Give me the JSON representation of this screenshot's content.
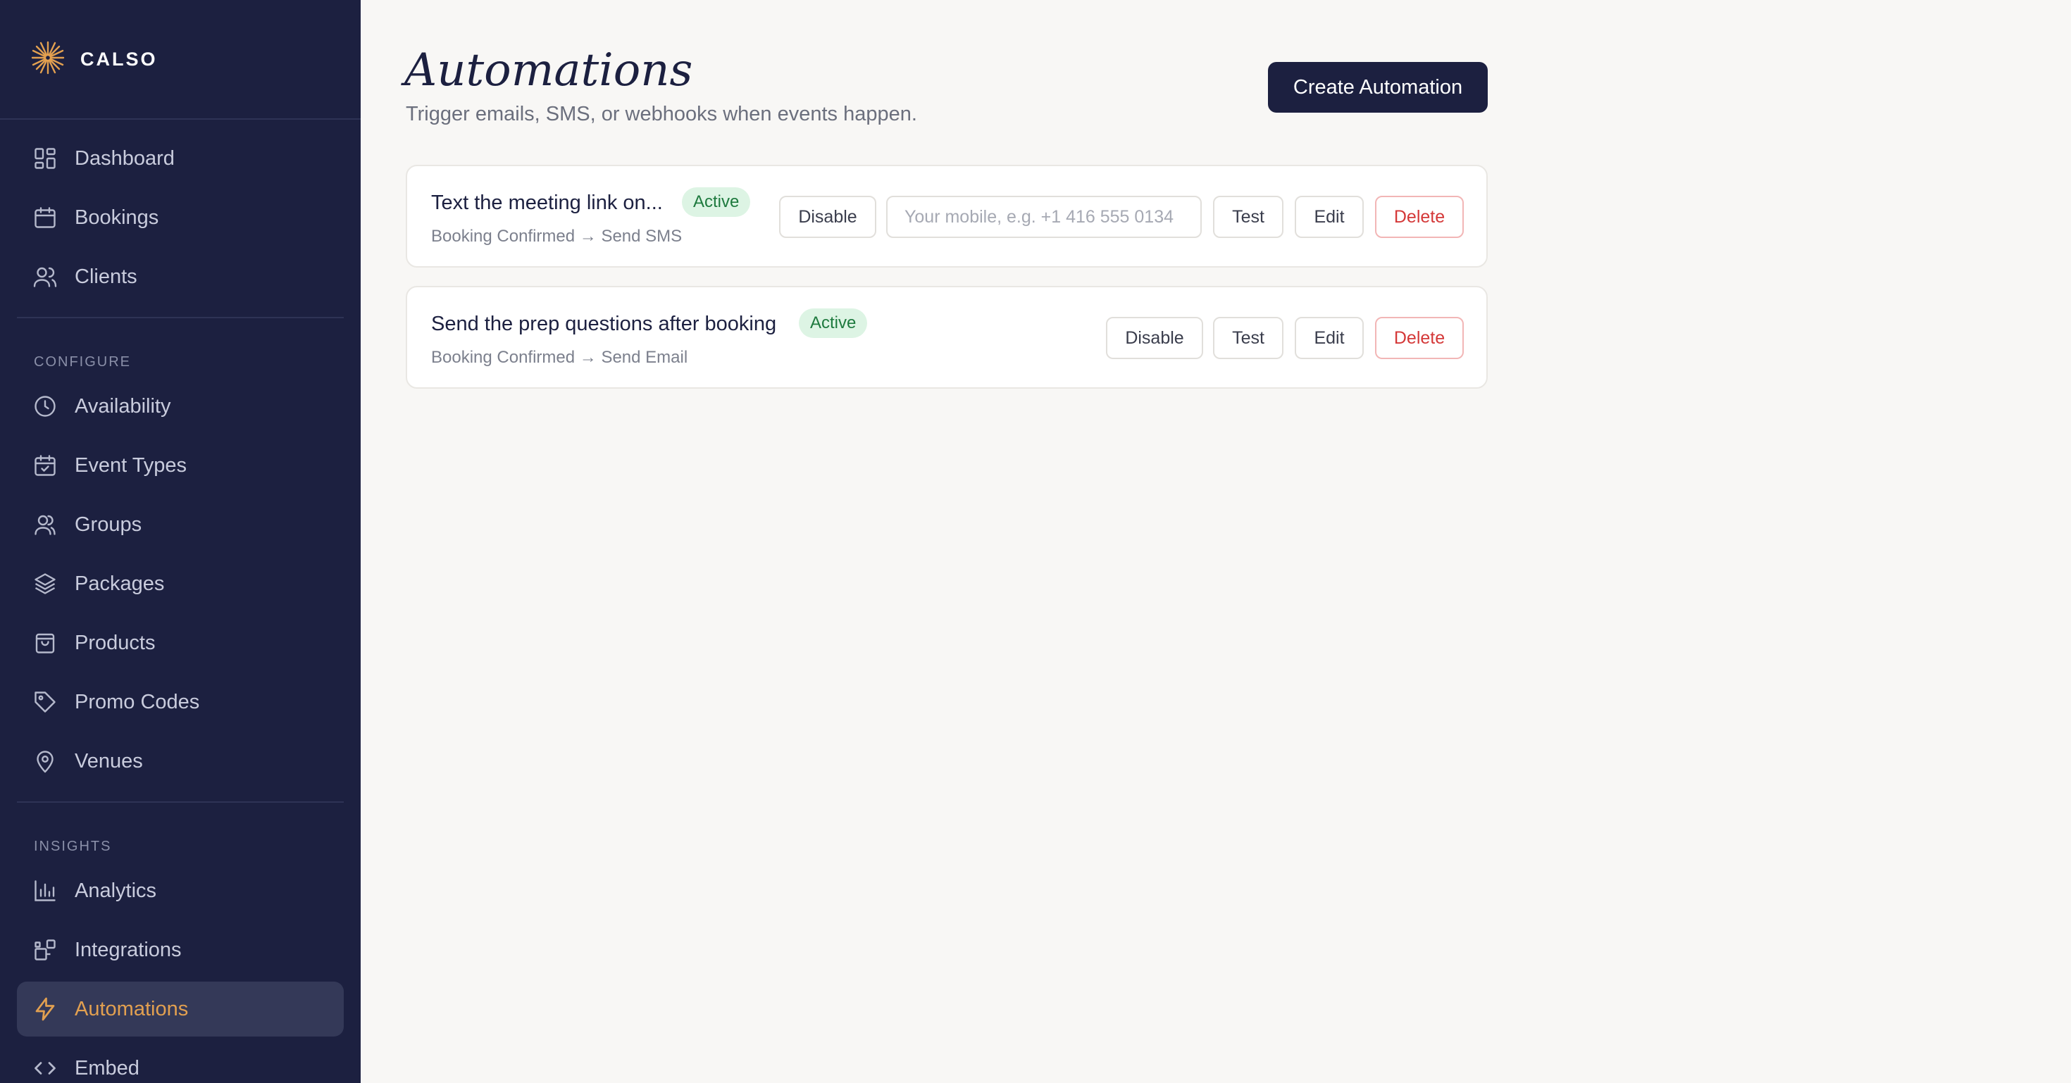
{
  "brand": {
    "name": "CALSO",
    "logo_icon": "sparkle-icon",
    "accent": "#e2a050"
  },
  "sidebar": {
    "main_items": [
      {
        "label": "Dashboard",
        "icon": "grid-icon"
      },
      {
        "label": "Bookings",
        "icon": "calendar-icon"
      },
      {
        "label": "Clients",
        "icon": "users-icon"
      }
    ],
    "configure": {
      "heading": "CONFIGURE",
      "items": [
        {
          "label": "Availability",
          "icon": "clock-icon"
        },
        {
          "label": "Event Types",
          "icon": "calendar-check-icon"
        },
        {
          "label": "Groups",
          "icon": "group-icon"
        },
        {
          "label": "Packages",
          "icon": "layers-icon"
        },
        {
          "label": "Products",
          "icon": "shopping-bag-icon"
        },
        {
          "label": "Promo Codes",
          "icon": "tag-icon"
        },
        {
          "label": "Venues",
          "icon": "map-pin-icon"
        }
      ]
    },
    "insights": {
      "heading": "INSIGHTS",
      "items": [
        {
          "label": "Analytics",
          "icon": "bar-chart-icon"
        },
        {
          "label": "Integrations",
          "icon": "puzzle-icon"
        },
        {
          "label": "Automations",
          "icon": "lightning-icon",
          "active": true
        },
        {
          "label": "Embed",
          "icon": "code-icon"
        }
      ]
    }
  },
  "main": {
    "title": "Automations",
    "subtitle": "Trigger emails, SMS, or webhooks when events happen.",
    "create_button": "Create Automation"
  },
  "automations": [
    {
      "name": "Text the meeting link on...",
      "status": "Active",
      "trigger": "Booking Confirmed → Send SMS",
      "disable_label": "Disable",
      "mobile_placeholder": "Your mobile, e.g. +1 416 555 0134",
      "test_label": "Test",
      "edit_label": "Edit",
      "delete_label": "Delete"
    },
    {
      "name": "Send the prep questions after booking",
      "status": "Active",
      "trigger": "Booking Confirmed → Send Email",
      "disable_label": "Disable",
      "test_label": "Test",
      "edit_label": "Edit",
      "delete_label": "Delete"
    }
  ]
}
